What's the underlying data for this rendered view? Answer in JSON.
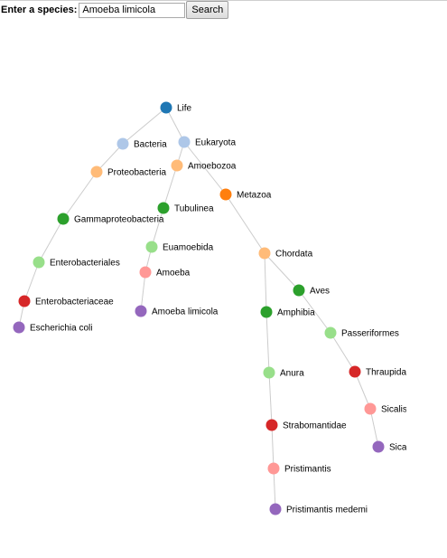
{
  "search": {
    "label": "Enter a species:",
    "value": "Amoeba limicola",
    "button_label": "Search"
  },
  "tree": {
    "nodes": [
      {
        "id": "life",
        "label": "Life",
        "color": "#1f77b4"
      },
      {
        "id": "bacteria",
        "label": "Bacteria",
        "color": "#aec7e8"
      },
      {
        "id": "eukaryota",
        "label": "Eukaryota",
        "color": "#aec7e8"
      },
      {
        "id": "proteobacteria",
        "label": "Proteobacteria",
        "color": "#ffbb78"
      },
      {
        "id": "amoebozoa",
        "label": "Amoebozoa",
        "color": "#ffbb78"
      },
      {
        "id": "metazoa",
        "label": "Metazoa",
        "color": "#ff7f0e"
      },
      {
        "id": "tubulinea",
        "label": "Tubulinea",
        "color": "#2ca02c"
      },
      {
        "id": "gammaproteobacteria",
        "label": "Gammaproteobacteria",
        "color": "#2ca02c"
      },
      {
        "id": "euamoebida",
        "label": "Euamoebida",
        "color": "#98df8a"
      },
      {
        "id": "chordata",
        "label": "Chordata",
        "color": "#ffbb78"
      },
      {
        "id": "enterobacteriales",
        "label": "Enterobacteriales",
        "color": "#98df8a"
      },
      {
        "id": "amoeba",
        "label": "Amoeba",
        "color": "#ff9896"
      },
      {
        "id": "aves",
        "label": "Aves",
        "color": "#2ca02c"
      },
      {
        "id": "enterobacteriaceae",
        "label": "Enterobacteriaceae",
        "color": "#d62728"
      },
      {
        "id": "amphibia",
        "label": "Amphibia",
        "color": "#2ca02c"
      },
      {
        "id": "amoeba-limicola",
        "label": "Amoeba limicola",
        "color": "#9467bd"
      },
      {
        "id": "escherichia-coli",
        "label": "Escherichia coli",
        "color": "#9467bd"
      },
      {
        "id": "passeriformes",
        "label": "Passeriformes",
        "color": "#98df8a"
      },
      {
        "id": "anura",
        "label": "Anura",
        "color": "#98df8a"
      },
      {
        "id": "thraupidae",
        "label": "Thraupida",
        "color": "#d62728"
      },
      {
        "id": "sicalis",
        "label": "Sicalis",
        "color": "#ff9896"
      },
      {
        "id": "strabomantidae",
        "label": "Strabomantidae",
        "color": "#d62728"
      },
      {
        "id": "sicalis-species",
        "label": "Sica",
        "color": "#9467bd"
      },
      {
        "id": "pristimantis",
        "label": "Pristimantis",
        "color": "#ff9896"
      },
      {
        "id": "pristimantis-medemi",
        "label": "Pristimantis medemi",
        "color": "#9467bd"
      }
    ],
    "links": [
      [
        "life",
        "bacteria"
      ],
      [
        "life",
        "eukaryota"
      ],
      [
        "bacteria",
        "proteobacteria"
      ],
      [
        "proteobacteria",
        "gammaproteobacteria"
      ],
      [
        "gammaproteobacteria",
        "enterobacteriales"
      ],
      [
        "enterobacteriales",
        "enterobacteriaceae"
      ],
      [
        "enterobacteriaceae",
        "escherichia-coli"
      ],
      [
        "eukaryota",
        "amoebozoa"
      ],
      [
        "eukaryota",
        "metazoa"
      ],
      [
        "amoebozoa",
        "tubulinea"
      ],
      [
        "tubulinea",
        "euamoebida"
      ],
      [
        "euamoebida",
        "amoeba"
      ],
      [
        "amoeba",
        "amoeba-limicola"
      ],
      [
        "metazoa",
        "chordata"
      ],
      [
        "chordata",
        "aves"
      ],
      [
        "chordata",
        "amphibia"
      ],
      [
        "aves",
        "passeriformes"
      ],
      [
        "passeriformes",
        "thraupidae"
      ],
      [
        "thraupidae",
        "sicalis"
      ],
      [
        "sicalis",
        "sicalis-species"
      ],
      [
        "amphibia",
        "anura"
      ],
      [
        "anura",
        "strabomantidae"
      ],
      [
        "strabomantidae",
        "pristimantis"
      ],
      [
        "pristimantis",
        "pristimantis-medemi"
      ]
    ]
  }
}
